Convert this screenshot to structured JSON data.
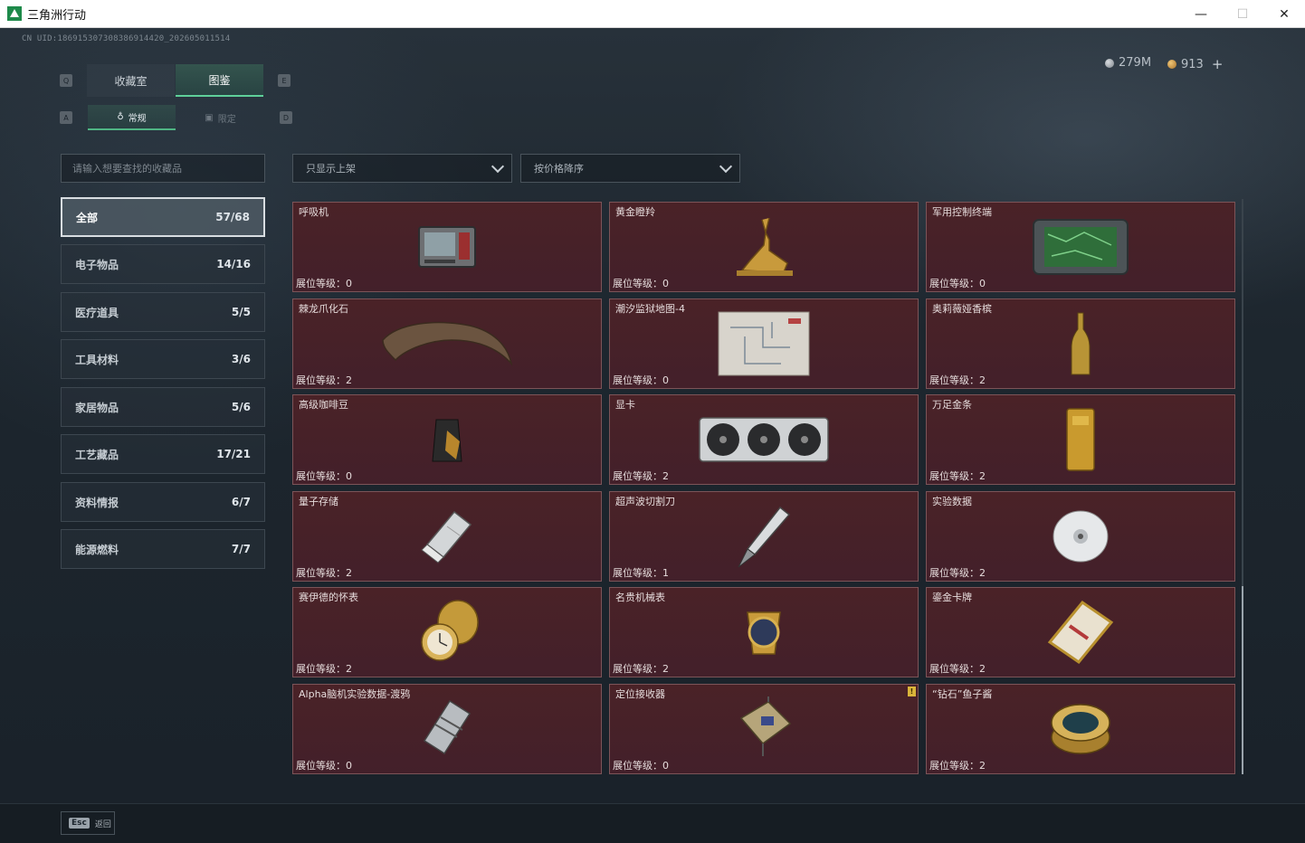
{
  "window": {
    "title": "三角洲行动",
    "minimize": "—",
    "maximize": "☐",
    "close": "✕"
  },
  "header": {
    "uid": "CN UID:1869153073083869144​20_202605011514",
    "currency_a": "279M",
    "currency_b": "913",
    "currency_b_plus": "+"
  },
  "tabs": {
    "left_key": "Q",
    "right_key": "E",
    "main": [
      {
        "label": "收藏室"
      },
      {
        "label": "图鉴"
      }
    ],
    "sub_left_key": "A",
    "sub_right_key": "D",
    "sub": [
      {
        "label": "常规"
      },
      {
        "label": "限定"
      }
    ]
  },
  "search": {
    "placeholder": "请输入想要查找的收藏品"
  },
  "filters": {
    "show": "只显示上架",
    "sort": "按价格降序"
  },
  "categories": [
    {
      "label": "全部",
      "count": "57/68"
    },
    {
      "label": "电子物品",
      "count": "14/16"
    },
    {
      "label": "医疗道具",
      "count": "5/5"
    },
    {
      "label": "工具材料",
      "count": "3/6"
    },
    {
      "label": "家居物品",
      "count": "5/6"
    },
    {
      "label": "工艺藏品",
      "count": "17/21"
    },
    {
      "label": "资料情报",
      "count": "6/7"
    },
    {
      "label": "能源燃料",
      "count": "7/7"
    }
  ],
  "items": [
    {
      "name": "呼吸机",
      "level": "展位等级：0"
    },
    {
      "name": "黄金瞪羚",
      "level": "展位等级：0"
    },
    {
      "name": "军用控制终端",
      "level": "展位等级：0"
    },
    {
      "name": "棘龙爪化石",
      "level": "展位等级：2"
    },
    {
      "name": "潮汐监狱地图-4",
      "level": "展位等级：0"
    },
    {
      "name": "奥莉薇娅香槟",
      "level": "展位等级：2"
    },
    {
      "name": "高级咖啡豆",
      "level": "展位等级：0"
    },
    {
      "name": "显卡",
      "level": "展位等级：2"
    },
    {
      "name": "万足金条",
      "level": "展位等级：2"
    },
    {
      "name": "量子存储",
      "level": "展位等级：2"
    },
    {
      "name": "超声波切割刀",
      "level": "展位等级：1"
    },
    {
      "name": "实验数据",
      "level": "展位等级：2"
    },
    {
      "name": "赛伊德的怀表",
      "level": "展位等级：2"
    },
    {
      "name": "名贵机械表",
      "level": "展位等级：2"
    },
    {
      "name": "鎏金卡牌",
      "level": "展位等级：2"
    },
    {
      "name": "Alpha脑机实验数据-渡鸦",
      "level": "展位等级：0"
    },
    {
      "name": "定位接收器",
      "level": "展位等级：0",
      "badge": "!"
    },
    {
      "name": "“钻石”鱼子酱",
      "level": "展位等级：2"
    }
  ],
  "footer": {
    "esc_key": "Esc",
    "esc_label": "返回"
  }
}
